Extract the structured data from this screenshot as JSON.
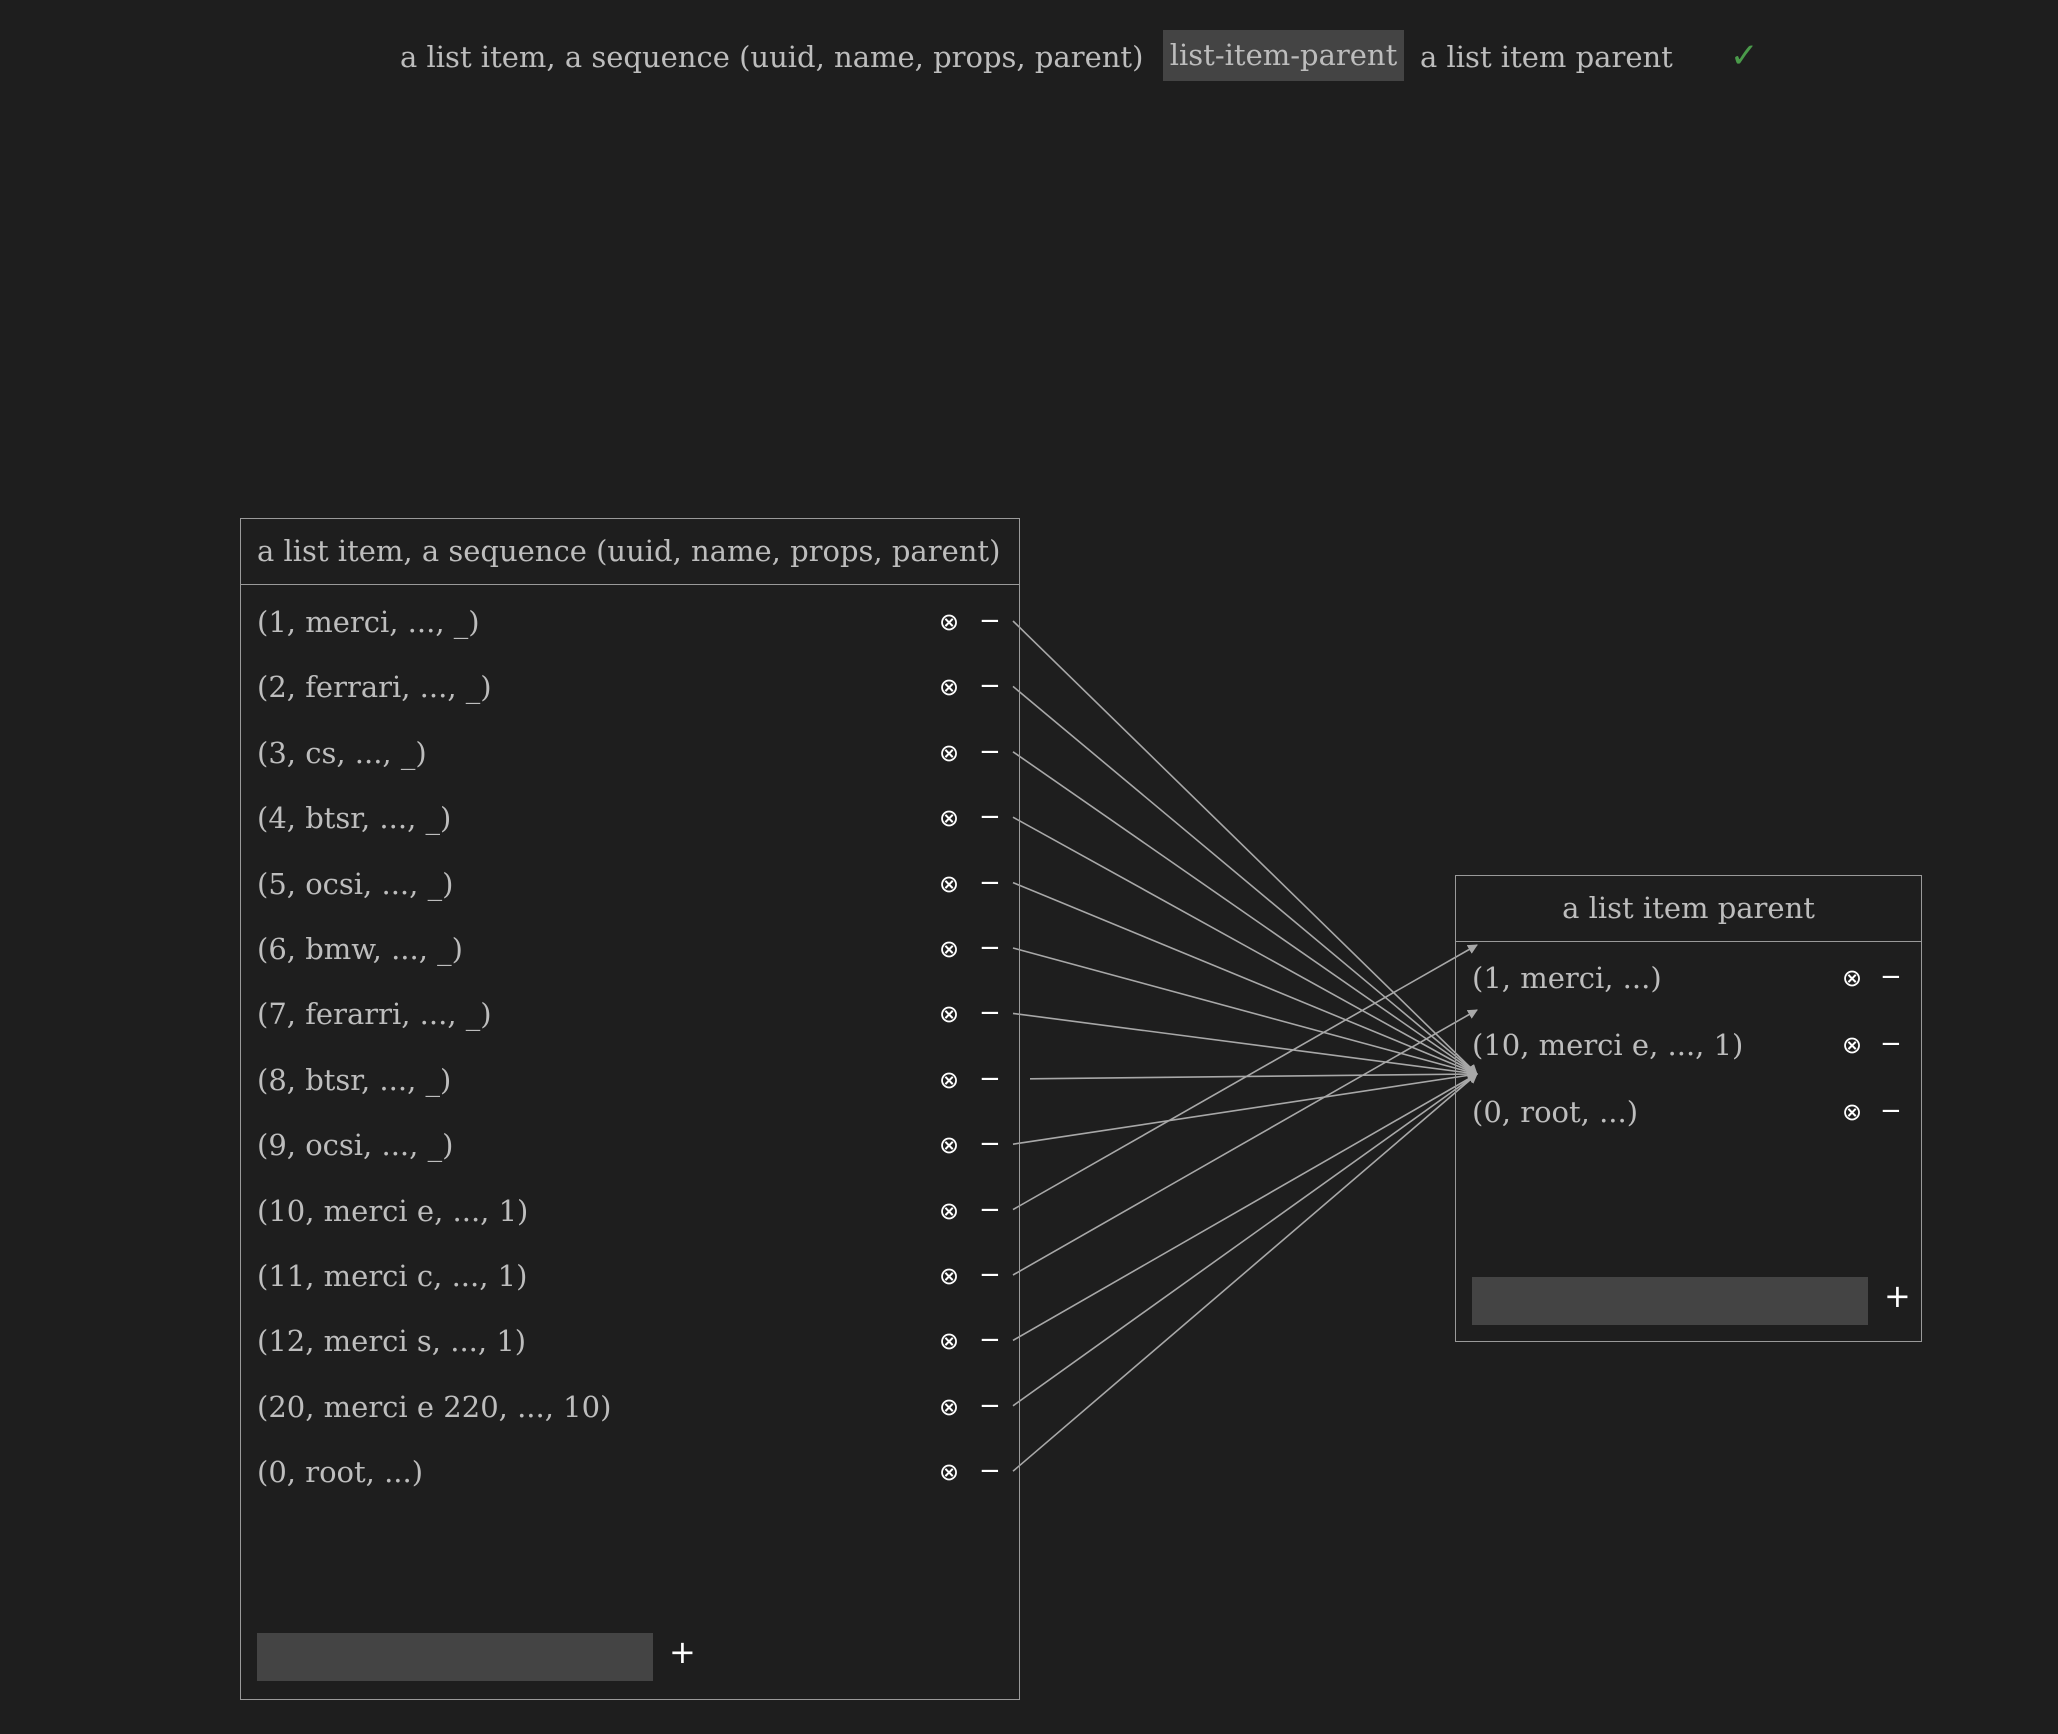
{
  "header": {
    "left_title": "a list item, a sequence (uuid, name, props, parent)",
    "relation_chip": "list-item-parent",
    "right_title": "a list item parent",
    "status_icon": "check-icon",
    "status_glyph": "✓",
    "status_color": "#4a9a4a"
  },
  "left_panel": {
    "title": "a list item, a sequence (uuid, name, props, parent)",
    "rows": [
      {
        "label": "(1, merci, ..., _)"
      },
      {
        "label": "(2, ferrari, ..., _)"
      },
      {
        "label": "(3, cs, ..., _)"
      },
      {
        "label": "(4, btsr, ..., _)"
      },
      {
        "label": "(5, ocsi, ..., _)"
      },
      {
        "label": "(6, bmw, ..., _)"
      },
      {
        "label": "(7, ferarri, ..., _)"
      },
      {
        "label": "(8, btsr, ..., _)"
      },
      {
        "label": "(9, ocsi, ..., _)"
      },
      {
        "label": "(10, merci e, ..., 1)"
      },
      {
        "label": "(11, merci c, ..., 1)"
      },
      {
        "label": "(12, merci s, ..., 1)"
      },
      {
        "label": "(20, merci e 220, ..., 10)"
      },
      {
        "label": "(0, root, ...)"
      }
    ],
    "add_value": "",
    "add_label": "+"
  },
  "right_panel": {
    "title": "a list item parent",
    "rows": [
      {
        "label": "(1, merci, ...)"
      },
      {
        "label": "(10, merci e, ..., 1)"
      },
      {
        "label": "(0, root, ...)"
      }
    ],
    "add_value": "",
    "add_label": "+"
  },
  "row_actions": {
    "remove_glyph": "⊗",
    "remove_icon": "circled-x-icon",
    "collapse_glyph": "−",
    "collapse_icon": "minus-icon"
  },
  "colors": {
    "background": "#1e1e1e",
    "text": "#bdbdbd",
    "border": "#9a9a9a",
    "chip": "#444444",
    "link": "#a8a8a8"
  }
}
